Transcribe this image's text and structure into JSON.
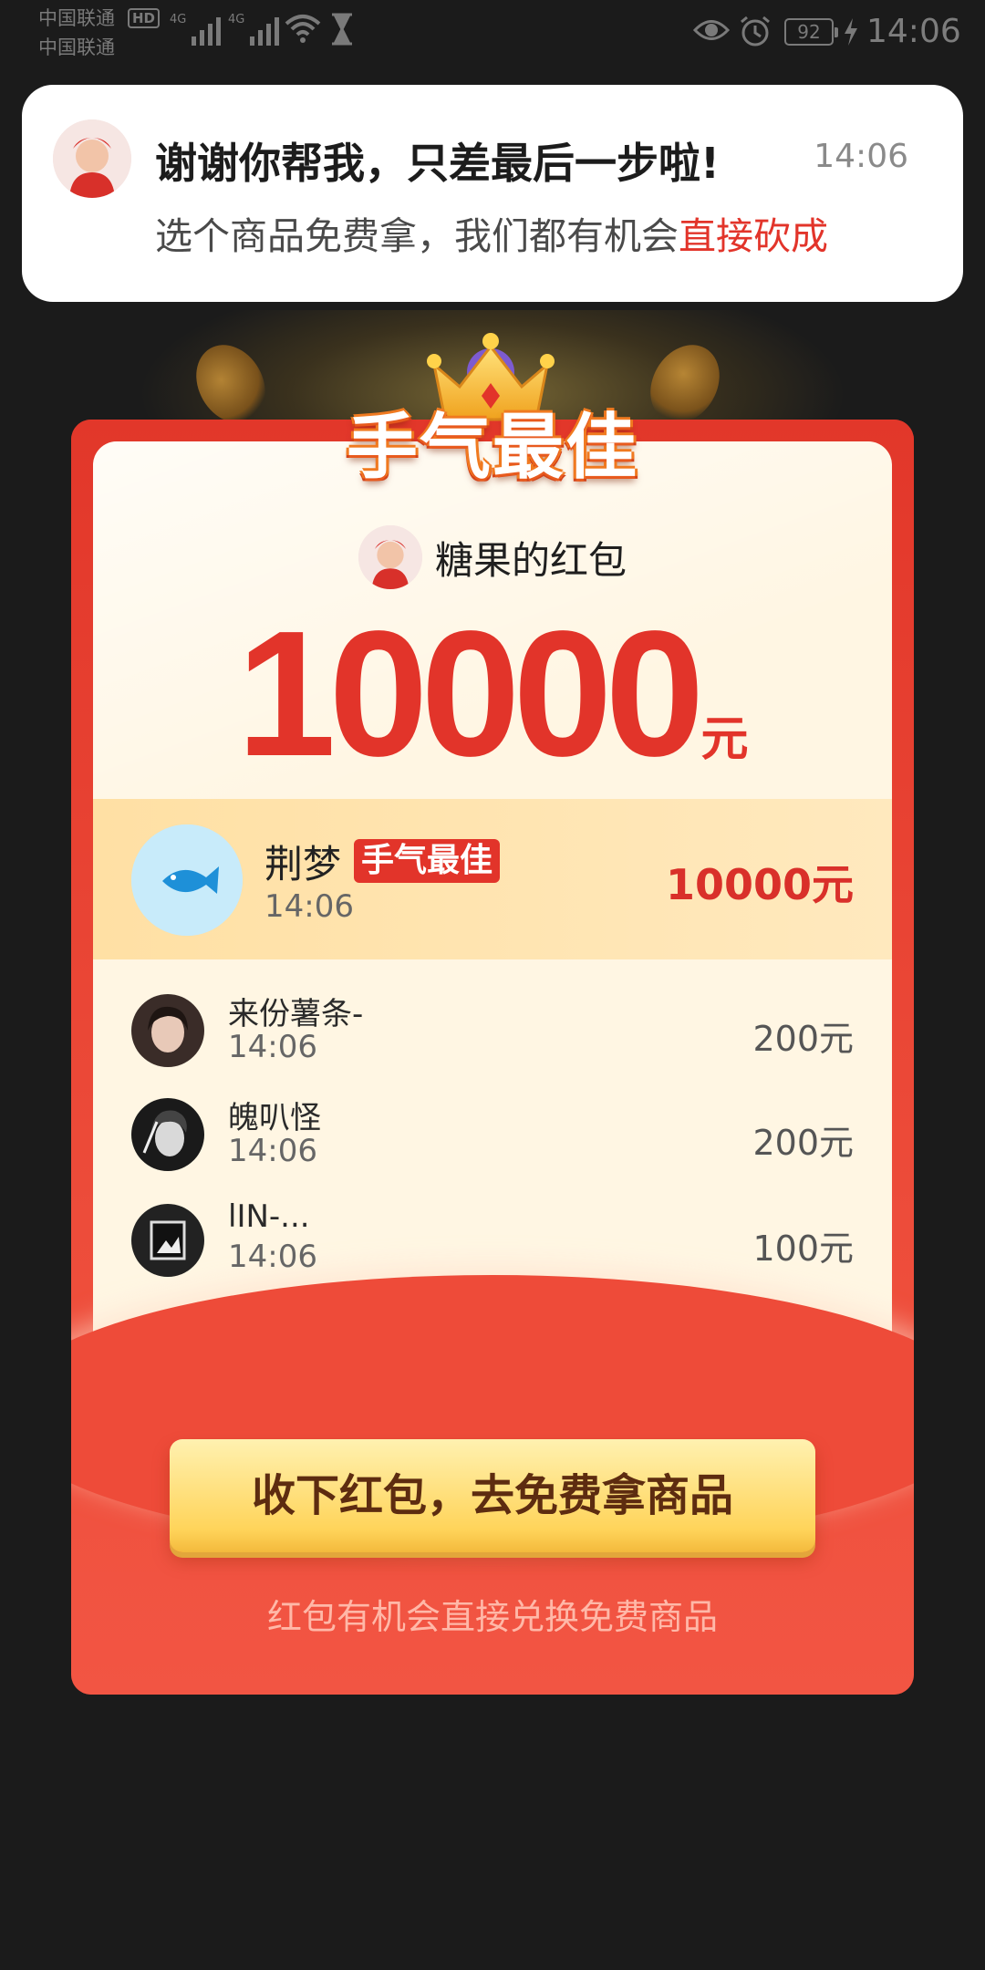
{
  "status_bar": {
    "carrier_1": "中国联通",
    "carrier_2": "中国联通",
    "hd": "HD",
    "network_1": "4G",
    "network_2": "4G",
    "battery": "92",
    "time": "14:06",
    "icons": [
      "signal-icon",
      "wifi-icon",
      "hourglass-icon",
      "eye-icon",
      "alarm-icon",
      "battery-icon",
      "charging-bolt-icon"
    ]
  },
  "notification": {
    "title": "谢谢你帮我，只差最后一步啦!",
    "time": "14:06",
    "body_prefix": "选个商品免费拿，我们都有机会",
    "body_highlight": "直接砍成"
  },
  "card": {
    "badge_title": "手气最佳",
    "sender_name": "糖果的红包",
    "amount": "10000",
    "amount_unit": "元"
  },
  "best_luck": {
    "name": "荆梦",
    "badge": "手气最佳",
    "time": "14:06",
    "amount": "10000元"
  },
  "recipients": [
    {
      "name": "来份薯条-",
      "time": "14:06",
      "amount": "200元"
    },
    {
      "name": "魄叭怪",
      "time": "14:06",
      "amount": "200元"
    },
    {
      "name": "lIN-...",
      "time": "14:06",
      "amount": "100元"
    }
  ],
  "actions": {
    "claim_button": "收下红包，去免费拿商品",
    "note": "红包有机会直接兑换免费商品"
  },
  "colors": {
    "background": "#1b1b1b",
    "card_red": "#e2372a",
    "highlight_red": "#e2342a",
    "panel_cream": "#fff6e3",
    "button_yellow": "#ffd45a"
  }
}
